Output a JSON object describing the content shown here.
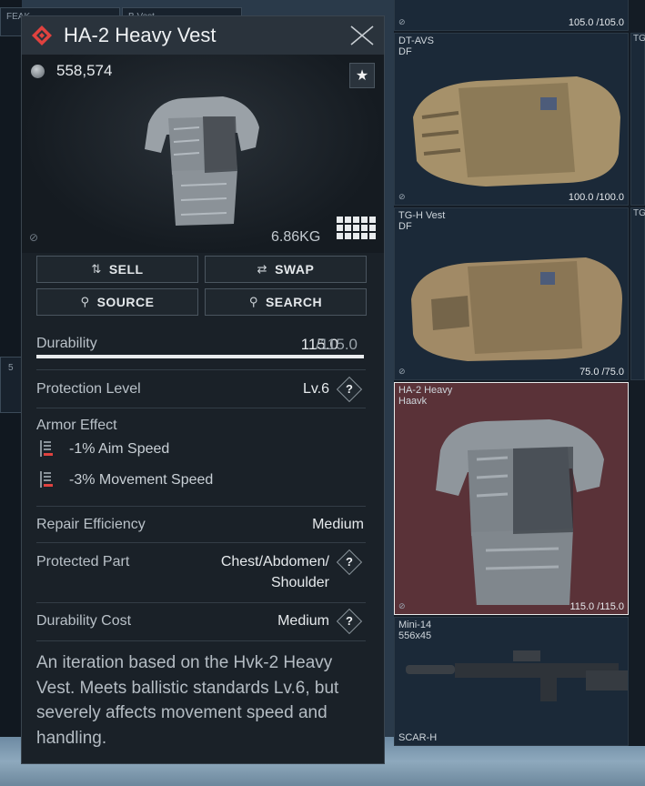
{
  "panel": {
    "title": "HA-2 Heavy Vest",
    "price": "558,574",
    "weight": "6.86KG",
    "buttons": {
      "sell": "SELL",
      "swap": "SWAP",
      "source": "SOURCE",
      "search": "SEARCH"
    },
    "durability": {
      "label": "Durability",
      "current": "115.0",
      "max": "/115.0",
      "fraction": 1.0
    },
    "protection_level": {
      "label": "Protection Level",
      "value": "Lv.6"
    },
    "armor_effect": {
      "label": "Armor Effect",
      "effects": [
        "-1% Aim Speed",
        "-3% Movement Speed"
      ]
    },
    "repair_efficiency": {
      "label": "Repair Efficiency",
      "value": "Medium"
    },
    "protected_part": {
      "label": "Protected Part",
      "value_line1": "Chest/Abdomen/",
      "value_line2": "Shoulder"
    },
    "durability_cost": {
      "label": "Durability Cost",
      "value": "Medium"
    },
    "description": "An iteration based on the Hvk-2 Heavy Vest. Meets ballistic standards Lv.6, but severely affects movement speed and handling.",
    "icons": {
      "rarity": "red-diamond-icon",
      "currency": "coin-icon",
      "favorite": "star-icon",
      "close": "close-icon",
      "sell": "sell-icon",
      "swap": "swap-icon",
      "search": "magnifier-icon",
      "effect": "debuff-bars-icon",
      "help": "question-icon"
    }
  },
  "inventory": [
    {
      "name": "",
      "durability": "105.0 /105.0"
    },
    {
      "name": "DT-AVS\nDF",
      "durability": "100.0 /100.0"
    },
    {
      "name": "TG-H Vest\nDF",
      "durability": "75.0 /75.0"
    },
    {
      "name": "HA-2 Heavy\nHaavk",
      "durability": "115.0 /115.0"
    },
    {
      "name": "Mini-14\n556x45",
      "durability": ""
    }
  ],
  "inventory_edge": [
    "TG",
    "TG"
  ],
  "inventory_bottom_label": "SCAR-H",
  "background": {
    "tab1": "FEAK",
    "tab2": "B Vest",
    "left_count": "5"
  },
  "colors": {
    "rarity_red": "#e0423f",
    "selected_cell": "#5a3238",
    "panel_bg": "#1a2128"
  }
}
